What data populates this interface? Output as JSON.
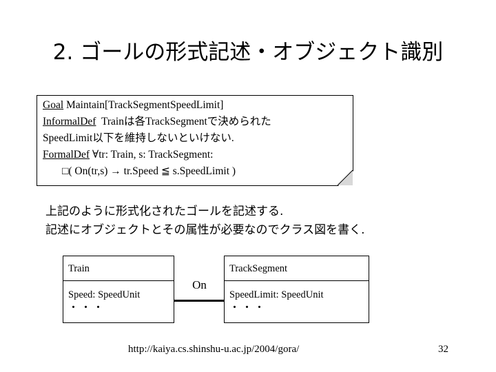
{
  "slide": {
    "title": "2. ゴールの形式記述・オブジェクト識別",
    "page_number": "32",
    "footer_url": "http://kaiya.cs.shinshu-u.ac.jp/2004/gora/",
    "background_color": "#ffffff",
    "text_color": "#000000"
  },
  "goal_box": {
    "keyword_goal": "Goal",
    "goal_value": "Maintain[TrackSegmentSpeedLimit]",
    "keyword_informal": "InformalDef",
    "informal_line1": "Trainは各TrackSegmentで決められた",
    "informal_line2": "SpeedLimit以下を維持しないといけない.",
    "keyword_formal": "FormalDef",
    "formal_line1": "∀tr: Train, s: TrackSegment:",
    "formal_line2": "□( On(tr,s) → tr.Speed ≦ s.SpeedLimit )",
    "fold_fill_color": "#d8d8d8"
  },
  "body": {
    "line1": "上記のように形式化されたゴールを記述する.",
    "line2": "記述にオブジェクトとその属性が必要なのでクラス図を書く."
  },
  "class_diagram": {
    "association_label": "On",
    "classes": [
      {
        "name": "Train",
        "attributes": [
          "Speed: SpeedUnit"
        ],
        "ellipsis": "・・・"
      },
      {
        "name": "TrackSegment",
        "attributes": [
          "SpeedLimit: SpeedUnit"
        ],
        "ellipsis": "・・・"
      }
    ]
  }
}
